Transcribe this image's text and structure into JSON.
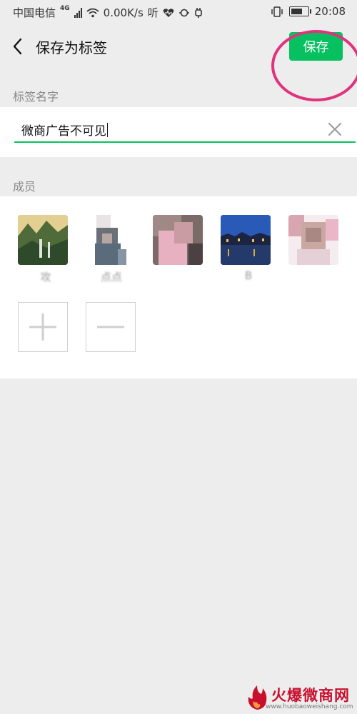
{
  "status_bar": {
    "carrier": "中国电信",
    "network": "4G",
    "speed": "0.00K/s",
    "ting": "听",
    "time": "20:08"
  },
  "header": {
    "title": "保存为标签",
    "save_label": "保存"
  },
  "tag_name": {
    "label": "标签名字",
    "value": "微商广告不可见"
  },
  "members": {
    "label": "成员",
    "items": [
      {
        "name": "攻"
      },
      {
        "name": "点点"
      },
      {
        "name": ""
      },
      {
        "name": "B"
      },
      {
        "name": ""
      }
    ]
  },
  "watermark": {
    "title": "火爆微商网",
    "url": "www.huobaoweishang.com"
  },
  "colors": {
    "accent": "#07c160",
    "highlight": "#e0337d",
    "background": "#ededed"
  }
}
